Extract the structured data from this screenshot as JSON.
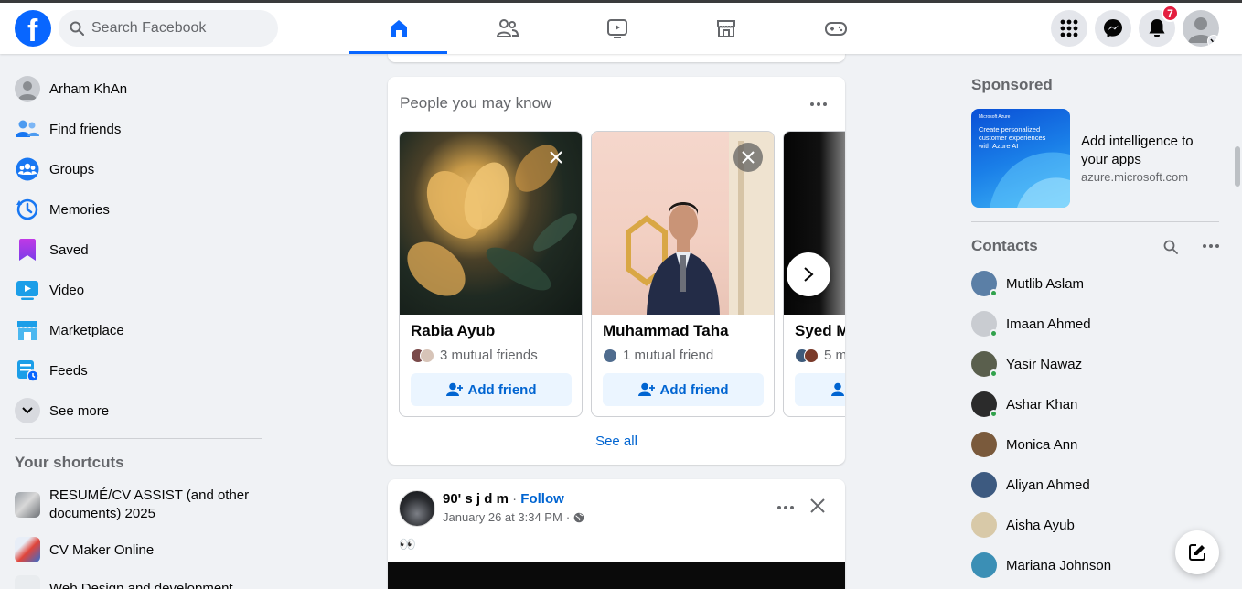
{
  "app": {
    "logo_letter": "f"
  },
  "search": {
    "placeholder": "Search Facebook"
  },
  "nav_tabs": [
    "home-icon",
    "friends-icon",
    "watch-icon",
    "marketplace-icon",
    "gaming-icon"
  ],
  "header": {
    "notifications_count": "7"
  },
  "sidebar": {
    "items": [
      {
        "label": "Arham KhAn",
        "icon": "profile-avatar"
      },
      {
        "label": "Find friends",
        "icon": "friends-icon"
      },
      {
        "label": "Groups",
        "icon": "groups-icon"
      },
      {
        "label": "Memories",
        "icon": "memories-icon"
      },
      {
        "label": "Saved",
        "icon": "saved-icon"
      },
      {
        "label": "Video",
        "icon": "video-icon"
      },
      {
        "label": "Marketplace",
        "icon": "marketplace-icon"
      },
      {
        "label": "Feeds",
        "icon": "feeds-icon"
      },
      {
        "label": "See more",
        "icon": "chevron-down-icon"
      }
    ],
    "shortcuts_title": "Your shortcuts",
    "shortcuts": [
      {
        "label": "RESUMÉ/CV ASSIST (and other documents) 2025"
      },
      {
        "label": "CV Maker Online"
      },
      {
        "label": "Web Design and development"
      }
    ]
  },
  "pymk": {
    "title": "People you may know",
    "people": [
      {
        "name": "Rabia Ayub",
        "mutual": "3 mutual friends",
        "add": "Add friend"
      },
      {
        "name": "Muhammad Taha",
        "mutual": "1 mutual friend",
        "add": "Add friend"
      },
      {
        "name": "Syed M",
        "mutual": "5 m",
        "add": ""
      }
    ],
    "see_all": "See all"
  },
  "post": {
    "author": "90' s j d m",
    "separator": "·",
    "follow": "Follow",
    "time": "January 26 at 3:34 PM",
    "time_separator": "·",
    "text": "👀"
  },
  "sponsored": {
    "title": "Sponsored",
    "ad_title": "Add intelligence to your apps",
    "ad_domain": "azure.microsoft.com",
    "ad_image_text": "Create personalized customer experiences with Azure AI",
    "ad_image_brand": "Microsoft Azure"
  },
  "contacts": {
    "title": "Contacts",
    "list": [
      {
        "name": "Mutlib Aslam",
        "online": true,
        "color": "#5b7fa6"
      },
      {
        "name": "Imaan Ahmed",
        "online": true,
        "color": "#c9ccd1"
      },
      {
        "name": "Yasir Nawaz",
        "online": true,
        "color": "#5a5f4d"
      },
      {
        "name": "Ashar Khan",
        "online": true,
        "color": "#2b2b2b"
      },
      {
        "name": "Monica Ann",
        "online": false,
        "color": "#7a5a3c"
      },
      {
        "name": "Aliyan Ahmed",
        "online": false,
        "color": "#3d5a80"
      },
      {
        "name": "Aisha Ayub",
        "online": false,
        "color": "#d8c9a8"
      },
      {
        "name": "Mariana Johnson",
        "online": false,
        "color": "#3b8fb5"
      }
    ]
  },
  "colors": {
    "brand": "#0866ff",
    "link": "#0064d1",
    "online": "#31a24c",
    "badge": "#e41e3f"
  }
}
